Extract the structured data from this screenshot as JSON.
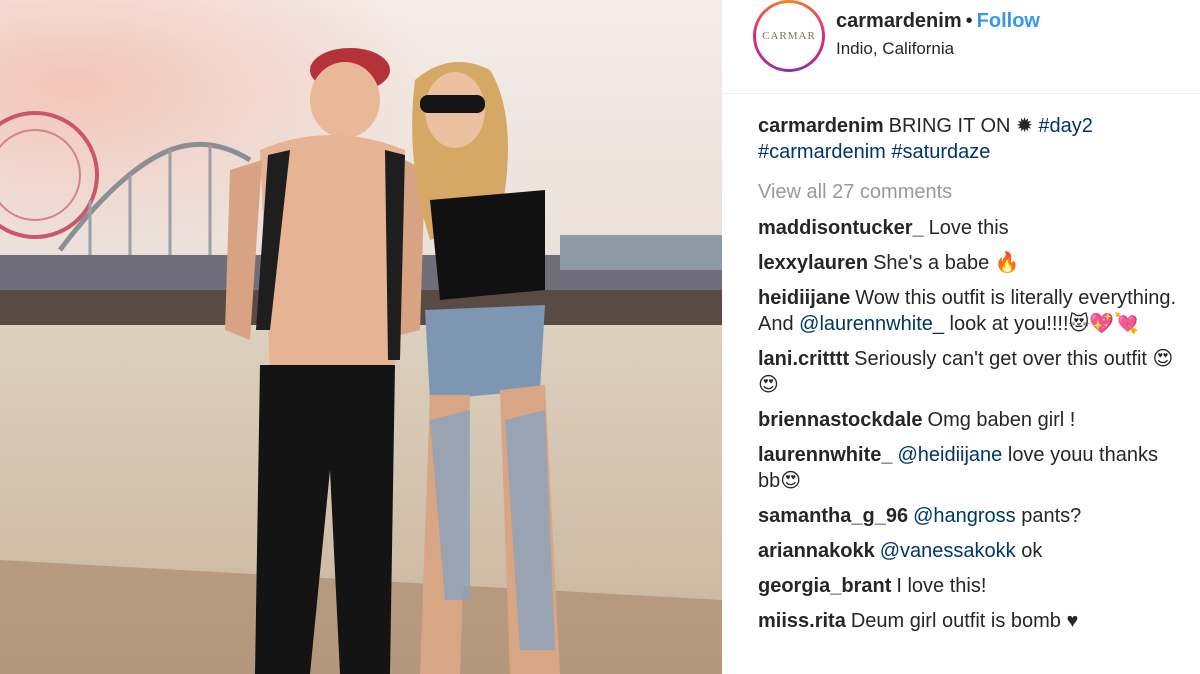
{
  "post": {
    "username": "carmardenim",
    "follow_label": "Follow",
    "separator": "•",
    "location": "Indio, California",
    "avatar_text": "CARMAR",
    "caption": {
      "username": "carmardenim",
      "text": "BRING IT ON",
      "emoji": "✹",
      "hashtags": [
        "#day2",
        "#carmardenim",
        "#saturdaze"
      ]
    },
    "view_all_label": "View all 27 comments"
  },
  "comments": [
    {
      "user": "maddisontucker_",
      "parts": [
        {
          "t": "Love this"
        }
      ]
    },
    {
      "user": "lexxylauren",
      "parts": [
        {
          "t": "She's a babe 🔥"
        }
      ]
    },
    {
      "user": "heidiijane",
      "parts": [
        {
          "t": "Wow this outfit is literally everything. And "
        },
        {
          "t": "@laurennwhite_",
          "tag": true
        },
        {
          "t": " look at you!!!!😻💖💘"
        }
      ]
    },
    {
      "user": "lani.critttt",
      "parts": [
        {
          "t": "Seriously can't get over this outfit 😍😍"
        }
      ]
    },
    {
      "user": "briennastockdale",
      "parts": [
        {
          "t": "Omg baben girl !"
        }
      ]
    },
    {
      "user": "laurennwhite_",
      "parts": [
        {
          "t": "@heidiijane",
          "tag": true
        },
        {
          "t": " love youu thanks bb😍"
        }
      ]
    },
    {
      "user": "samantha_g_96",
      "parts": [
        {
          "t": "@hangross",
          "tag": true
        },
        {
          "t": " pants?"
        }
      ]
    },
    {
      "user": "ariannakokk",
      "parts": [
        {
          "t": "@vanessakokk",
          "tag": true
        },
        {
          "t": " ok"
        }
      ]
    },
    {
      "user": "georgia_brant",
      "parts": [
        {
          "t": "I love this!"
        }
      ]
    },
    {
      "user": "miiss.rita",
      "parts": [
        {
          "t": "Deum girl outfit is bomb ♥"
        }
      ]
    }
  ]
}
